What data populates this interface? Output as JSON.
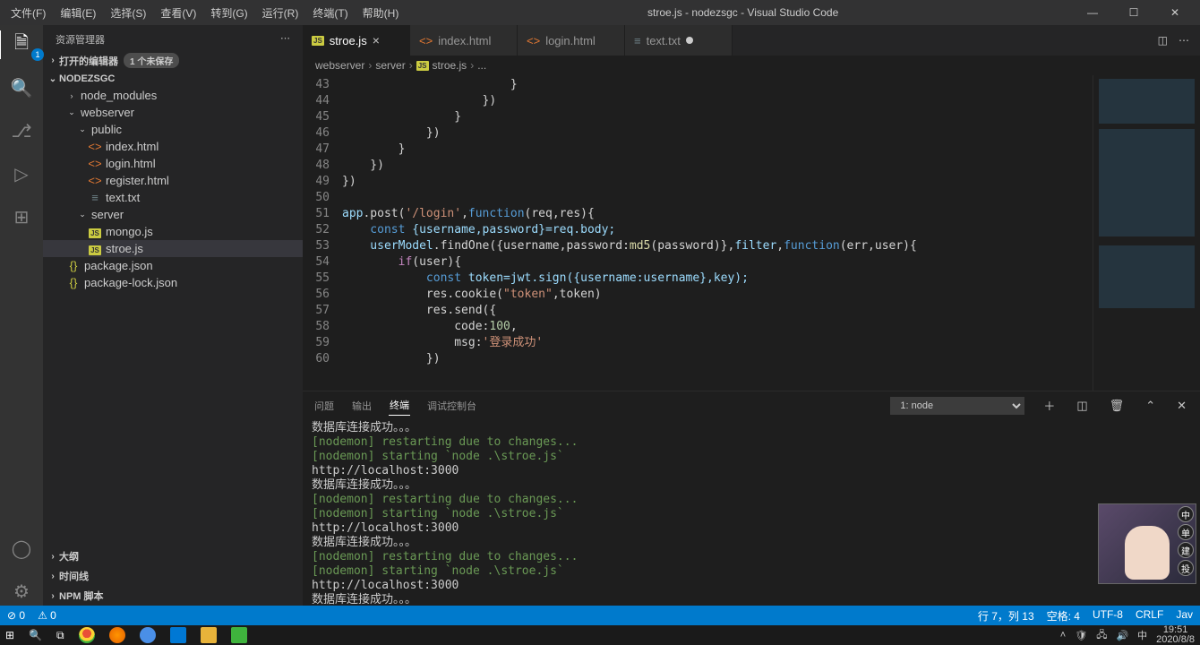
{
  "menu": {
    "file": "文件(F)",
    "edit": "编辑(E)",
    "select": "选择(S)",
    "view": "查看(V)",
    "goto": "转到(G)",
    "run": "运行(R)",
    "terminal": "终端(T)",
    "help": "帮助(H)"
  },
  "window_title": "stroe.js - nodezsgc - Visual Studio Code",
  "explorer": {
    "title": "资源管理器",
    "open_editors_label": "打开的编辑器",
    "unsaved_badge": "1 个未保存",
    "project": "NODEZSGC",
    "tree": {
      "node_modules": "node_modules",
      "webserver": "webserver",
      "public": "public",
      "index_html": "index.html",
      "login_html": "login.html",
      "register_html": "register.html",
      "text_txt": "text.txt",
      "server": "server",
      "mongo_js": "mongo.js",
      "stroe_js": "stroe.js",
      "package_json": "package.json",
      "package_lock": "package-lock.json"
    },
    "outline": "大纲",
    "timeline": "时间线",
    "npm_scripts": "NPM 脚本"
  },
  "tabs": {
    "stroe": "stroe.js",
    "index": "index.html",
    "login": "login.html",
    "text": "text.txt"
  },
  "breadcrumb": {
    "p0": "webserver",
    "p1": "server",
    "p2": "stroe.js",
    "p3": "..."
  },
  "code": {
    "l43": "                        }",
    "l44": "                    })",
    "l45": "                }",
    "l46": "            })",
    "l47": "        }",
    "l48": "    })",
    "l49": "})",
    "l50": "",
    "l51_a": "app",
    "l51_b": ".post(",
    "l51_c": "'/login'",
    "l51_d": ",",
    "l51_e": "function",
    "l51_f": "(req,res){",
    "l52_a": "    const",
    "l52_b": " {username,password}=req.body;",
    "l53_a": "    userModel",
    "l53_b": ".findOne({username,password:",
    "l53_c": "md5",
    "l53_d": "(password)},",
    "l53_e": "filter",
    "l53_f": ",",
    "l53_g": "function",
    "l53_h": "(err,user){",
    "l54_a": "        if",
    "l54_b": "(user){",
    "l55_a": "            const",
    "l55_b": " token=jwt.sign({username:username},key);",
    "l56_a": "            res.cookie(",
    "l56_b": "\"token\"",
    "l56_c": ",token)",
    "l57_a": "            res.send({",
    "l58_a": "                code:",
    "l58_b": "100",
    "l58_c": ",",
    "l59_a": "                msg:",
    "l59_b": "'登录成功'",
    "l60_a": "            })",
    "lines": [
      "43",
      "44",
      "45",
      "46",
      "47",
      "48",
      "49",
      "50",
      "51",
      "52",
      "53",
      "54",
      "55",
      "56",
      "57",
      "58",
      "59",
      "60"
    ]
  },
  "panel": {
    "tabs": {
      "problems": "问题",
      "output": "输出",
      "terminal": "终端",
      "debug_console": "调试控制台"
    },
    "select": "1: node",
    "lines": [
      {
        "c": "w",
        "t": "数据库连接成功。。。"
      },
      {
        "c": "g",
        "t": "[nodemon] restarting due to changes..."
      },
      {
        "c": "g",
        "t": "[nodemon] starting `node .\\stroe.js`"
      },
      {
        "c": "w",
        "t": "http://localhost:3000"
      },
      {
        "c": "w",
        "t": "数据库连接成功。。。"
      },
      {
        "c": "g",
        "t": "[nodemon] restarting due to changes..."
      },
      {
        "c": "g",
        "t": "[nodemon] starting `node .\\stroe.js`"
      },
      {
        "c": "w",
        "t": "http://localhost:3000"
      },
      {
        "c": "w",
        "t": "数据库连接成功。。。"
      },
      {
        "c": "g",
        "t": "[nodemon] restarting due to changes..."
      },
      {
        "c": "g",
        "t": "[nodemon] starting `node .\\stroe.js`"
      },
      {
        "c": "w",
        "t": "http://localhost:3000"
      },
      {
        "c": "w",
        "t": "数据库连接成功。。。"
      },
      {
        "c": "w",
        "t": "∎"
      }
    ]
  },
  "status": {
    "errors": "⊘ 0",
    "warnings": "⚠ 0",
    "pos": "行 7，列 13",
    "spaces": "空格: 4",
    "enc": "UTF-8",
    "eol": "CRLF",
    "lang": "Jav"
  },
  "clock": {
    "time": "19:51",
    "date": "2020/8/8"
  },
  "overlay_chars": [
    "中",
    "单",
    "建",
    "投"
  ]
}
